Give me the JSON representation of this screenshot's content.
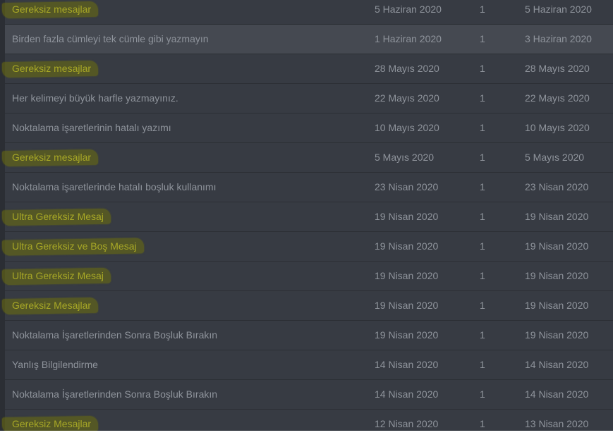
{
  "colors": {
    "row_bg": "#373b43",
    "row_hover_bg": "#454951",
    "text": "#8f949c",
    "marker_text": "#a8a826",
    "marker": "#6e700c"
  },
  "rows": [
    {
      "title": "Gereksiz mesajlar",
      "started": "5 Haziran 2020",
      "count": "1",
      "last": "5 Haziran 2020",
      "marked": true
    },
    {
      "title": "Birden fazla cümleyi tek cümle gibi yazmayın",
      "started": "1 Haziran 2020",
      "count": "1",
      "last": "3 Haziran 2020",
      "marked": false,
      "hover": true
    },
    {
      "title": "Gereksiz mesajlar",
      "started": "28 Mayıs 2020",
      "count": "1",
      "last": "28 Mayıs 2020",
      "marked": true
    },
    {
      "title": "Her kelimeyi büyük harfle yazmayınız.",
      "started": "22 Mayıs 2020",
      "count": "1",
      "last": "22 Mayıs 2020",
      "marked": false
    },
    {
      "title": "Noktalama işaretlerinin hatalı yazımı",
      "started": "10 Mayıs 2020",
      "count": "1",
      "last": "10 Mayıs 2020",
      "marked": false
    },
    {
      "title": "Gereksiz mesajlar",
      "started": "5 Mayıs 2020",
      "count": "1",
      "last": "5 Mayıs 2020",
      "marked": true
    },
    {
      "title": "Noktalama işaretlerinde hatalı boşluk kullanımı",
      "started": "23 Nisan 2020",
      "count": "1",
      "last": "23 Nisan 2020",
      "marked": false
    },
    {
      "title": "Ultra Gereksiz Mesaj",
      "started": "19 Nisan 2020",
      "count": "1",
      "last": "19 Nisan 2020",
      "marked": true
    },
    {
      "title": "Ultra Gereksiz ve Boş Mesaj",
      "started": "19 Nisan 2020",
      "count": "1",
      "last": "19 Nisan 2020",
      "marked": true
    },
    {
      "title": "Ultra Gereksiz Mesaj",
      "started": "19 Nisan 2020",
      "count": "1",
      "last": "19 Nisan 2020",
      "marked": true
    },
    {
      "title": "Gereksiz Mesajlar",
      "started": "19 Nisan 2020",
      "count": "1",
      "last": "19 Nisan 2020",
      "marked": true
    },
    {
      "title": "Noktalama İşaretlerinden Sonra Boşluk Bırakın",
      "started": "19 Nisan 2020",
      "count": "1",
      "last": "19 Nisan 2020",
      "marked": false
    },
    {
      "title": "Yanlış Bilgilendirme",
      "started": "14 Nisan 2020",
      "count": "1",
      "last": "14 Nisan 2020",
      "marked": false
    },
    {
      "title": "Noktalama İşaretlerinden Sonra Boşluk Bırakın",
      "started": "14 Nisan 2020",
      "count": "1",
      "last": "14 Nisan 2020",
      "marked": false
    },
    {
      "title": "Gereksiz Mesajlar",
      "started": "12 Nisan 2020",
      "count": "1",
      "last": "13 Nisan 2020",
      "marked": true
    }
  ]
}
